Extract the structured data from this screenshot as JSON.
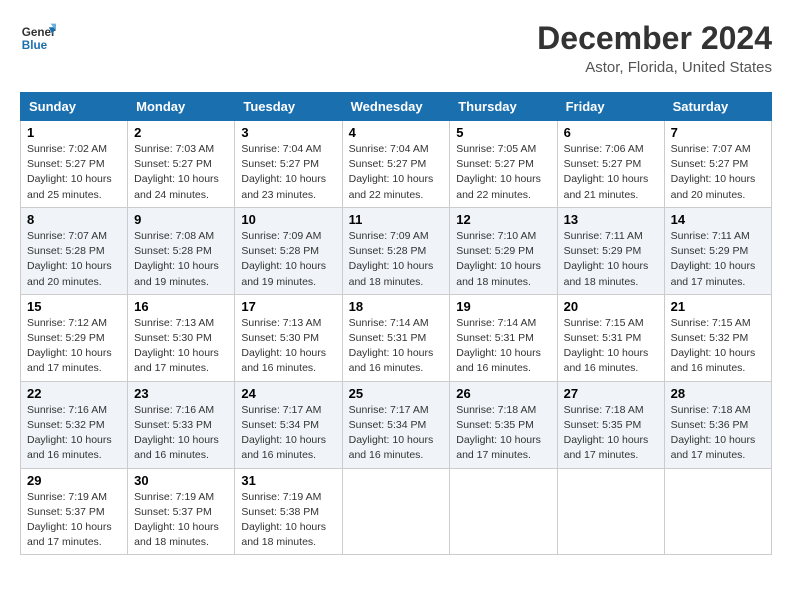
{
  "header": {
    "logo_line1": "General",
    "logo_line2": "Blue",
    "month": "December 2024",
    "location": "Astor, Florida, United States"
  },
  "weekdays": [
    "Sunday",
    "Monday",
    "Tuesday",
    "Wednesday",
    "Thursday",
    "Friday",
    "Saturday"
  ],
  "weeks": [
    [
      {
        "day": "1",
        "info": "Sunrise: 7:02 AM\nSunset: 5:27 PM\nDaylight: 10 hours\nand 25 minutes."
      },
      {
        "day": "2",
        "info": "Sunrise: 7:03 AM\nSunset: 5:27 PM\nDaylight: 10 hours\nand 24 minutes."
      },
      {
        "day": "3",
        "info": "Sunrise: 7:04 AM\nSunset: 5:27 PM\nDaylight: 10 hours\nand 23 minutes."
      },
      {
        "day": "4",
        "info": "Sunrise: 7:04 AM\nSunset: 5:27 PM\nDaylight: 10 hours\nand 22 minutes."
      },
      {
        "day": "5",
        "info": "Sunrise: 7:05 AM\nSunset: 5:27 PM\nDaylight: 10 hours\nand 22 minutes."
      },
      {
        "day": "6",
        "info": "Sunrise: 7:06 AM\nSunset: 5:27 PM\nDaylight: 10 hours\nand 21 minutes."
      },
      {
        "day": "7",
        "info": "Sunrise: 7:07 AM\nSunset: 5:27 PM\nDaylight: 10 hours\nand 20 minutes."
      }
    ],
    [
      {
        "day": "8",
        "info": "Sunrise: 7:07 AM\nSunset: 5:28 PM\nDaylight: 10 hours\nand 20 minutes."
      },
      {
        "day": "9",
        "info": "Sunrise: 7:08 AM\nSunset: 5:28 PM\nDaylight: 10 hours\nand 19 minutes."
      },
      {
        "day": "10",
        "info": "Sunrise: 7:09 AM\nSunset: 5:28 PM\nDaylight: 10 hours\nand 19 minutes."
      },
      {
        "day": "11",
        "info": "Sunrise: 7:09 AM\nSunset: 5:28 PM\nDaylight: 10 hours\nand 18 minutes."
      },
      {
        "day": "12",
        "info": "Sunrise: 7:10 AM\nSunset: 5:29 PM\nDaylight: 10 hours\nand 18 minutes."
      },
      {
        "day": "13",
        "info": "Sunrise: 7:11 AM\nSunset: 5:29 PM\nDaylight: 10 hours\nand 18 minutes."
      },
      {
        "day": "14",
        "info": "Sunrise: 7:11 AM\nSunset: 5:29 PM\nDaylight: 10 hours\nand 17 minutes."
      }
    ],
    [
      {
        "day": "15",
        "info": "Sunrise: 7:12 AM\nSunset: 5:29 PM\nDaylight: 10 hours\nand 17 minutes."
      },
      {
        "day": "16",
        "info": "Sunrise: 7:13 AM\nSunset: 5:30 PM\nDaylight: 10 hours\nand 17 minutes."
      },
      {
        "day": "17",
        "info": "Sunrise: 7:13 AM\nSunset: 5:30 PM\nDaylight: 10 hours\nand 16 minutes."
      },
      {
        "day": "18",
        "info": "Sunrise: 7:14 AM\nSunset: 5:31 PM\nDaylight: 10 hours\nand 16 minutes."
      },
      {
        "day": "19",
        "info": "Sunrise: 7:14 AM\nSunset: 5:31 PM\nDaylight: 10 hours\nand 16 minutes."
      },
      {
        "day": "20",
        "info": "Sunrise: 7:15 AM\nSunset: 5:31 PM\nDaylight: 10 hours\nand 16 minutes."
      },
      {
        "day": "21",
        "info": "Sunrise: 7:15 AM\nSunset: 5:32 PM\nDaylight: 10 hours\nand 16 minutes."
      }
    ],
    [
      {
        "day": "22",
        "info": "Sunrise: 7:16 AM\nSunset: 5:32 PM\nDaylight: 10 hours\nand 16 minutes."
      },
      {
        "day": "23",
        "info": "Sunrise: 7:16 AM\nSunset: 5:33 PM\nDaylight: 10 hours\nand 16 minutes."
      },
      {
        "day": "24",
        "info": "Sunrise: 7:17 AM\nSunset: 5:34 PM\nDaylight: 10 hours\nand 16 minutes."
      },
      {
        "day": "25",
        "info": "Sunrise: 7:17 AM\nSunset: 5:34 PM\nDaylight: 10 hours\nand 16 minutes."
      },
      {
        "day": "26",
        "info": "Sunrise: 7:18 AM\nSunset: 5:35 PM\nDaylight: 10 hours\nand 17 minutes."
      },
      {
        "day": "27",
        "info": "Sunrise: 7:18 AM\nSunset: 5:35 PM\nDaylight: 10 hours\nand 17 minutes."
      },
      {
        "day": "28",
        "info": "Sunrise: 7:18 AM\nSunset: 5:36 PM\nDaylight: 10 hours\nand 17 minutes."
      }
    ],
    [
      {
        "day": "29",
        "info": "Sunrise: 7:19 AM\nSunset: 5:37 PM\nDaylight: 10 hours\nand 17 minutes."
      },
      {
        "day": "30",
        "info": "Sunrise: 7:19 AM\nSunset: 5:37 PM\nDaylight: 10 hours\nand 18 minutes."
      },
      {
        "day": "31",
        "info": "Sunrise: 7:19 AM\nSunset: 5:38 PM\nDaylight: 10 hours\nand 18 minutes."
      },
      {
        "day": "",
        "info": ""
      },
      {
        "day": "",
        "info": ""
      },
      {
        "day": "",
        "info": ""
      },
      {
        "day": "",
        "info": ""
      }
    ]
  ]
}
